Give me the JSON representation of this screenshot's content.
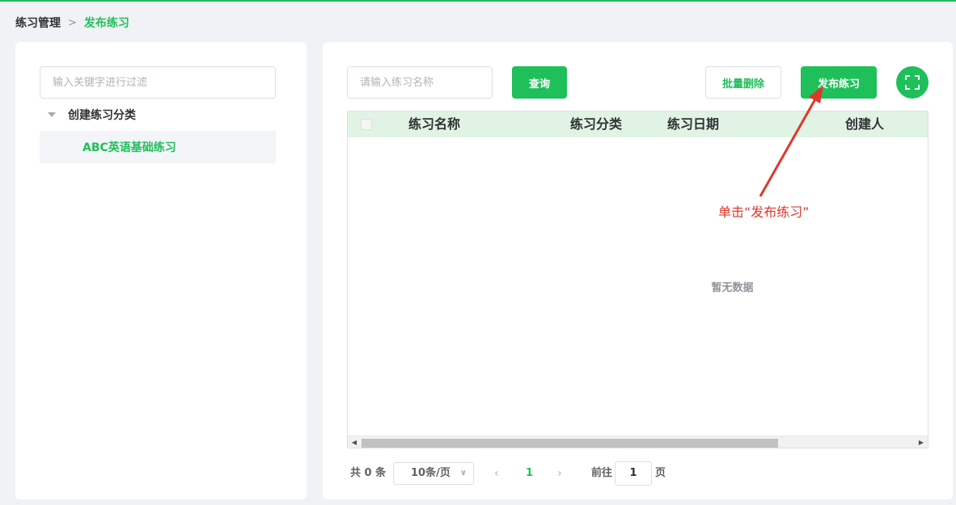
{
  "breadcrumb": {
    "root": "练习管理",
    "separator": ">",
    "current": "发布练习"
  },
  "sidebar": {
    "filter_placeholder": "输入关键字进行过滤",
    "tree": {
      "parent_label": "创建练习分类",
      "child_label": "ABC英语基础练习"
    }
  },
  "toolbar": {
    "search_placeholder": "请输入练习名称",
    "query_label": "查询",
    "batch_delete_label": "批量删除",
    "publish_label": "发布练习",
    "fullscreen_icon": "fullscreen-icon"
  },
  "table": {
    "columns": [
      "练习名称",
      "练习分类",
      "练习日期",
      "创建人"
    ],
    "empty_text": "暂无数据"
  },
  "pagination": {
    "total": "共 0 条",
    "page_size": "10条/页",
    "current_page": "1",
    "goto_label": "前往",
    "jump_value": "1",
    "page_suffix": "页"
  },
  "annotation": {
    "text": "单击“发布练习”",
    "color": "#e0372b"
  },
  "colors": {
    "accent": "#1fbf5a",
    "header_bg": "#e1f3e4"
  }
}
